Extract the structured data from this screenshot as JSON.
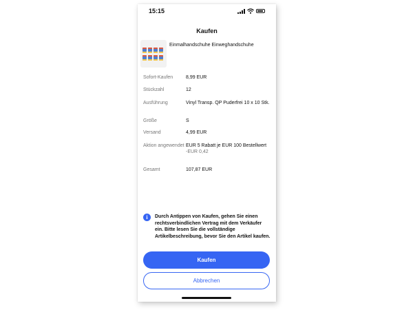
{
  "status_bar": {
    "time": "15:15",
    "icons": [
      "signal-icon",
      "wifi-icon",
      "battery-icon"
    ]
  },
  "header": {
    "title": "Kaufen"
  },
  "product": {
    "title": "Einmalhandschuhe Einweghandschuhe"
  },
  "details": [
    {
      "label": "Sofort-Kaufen",
      "value": "8,99 EUR"
    },
    {
      "label": "Stückzahl",
      "value": "12"
    },
    {
      "label": "Ausführung",
      "value": "Vinyl Transp. QP Puderfrei 10 x 10 Stk."
    },
    {
      "label": "Größe",
      "value": "S"
    },
    {
      "label": "Versand",
      "value": "4,99 EUR"
    },
    {
      "label": "Aktion angewendet",
      "value": "EUR 5 Rabatt je EUR 100 Bestellwert",
      "sub": "-EUR 0,42"
    },
    {
      "label": "Gesamt",
      "value": "107,87 EUR"
    }
  ],
  "notice": {
    "icon": "info-icon",
    "text": "Durch Antippen von Kaufen, gehen Sie einen rechtsverbindlichen Vertrag mit dem Verkäufer ein. Bitte lesen Sie die vollständige Artikelbeschreibung, bevor Sie den Artikel kaufen."
  },
  "actions": {
    "buy_label": "Kaufen",
    "cancel_label": "Abbrechen"
  },
  "colors": {
    "accent": "#3665f3",
    "label_gray": "#767676",
    "text": "#111111"
  }
}
